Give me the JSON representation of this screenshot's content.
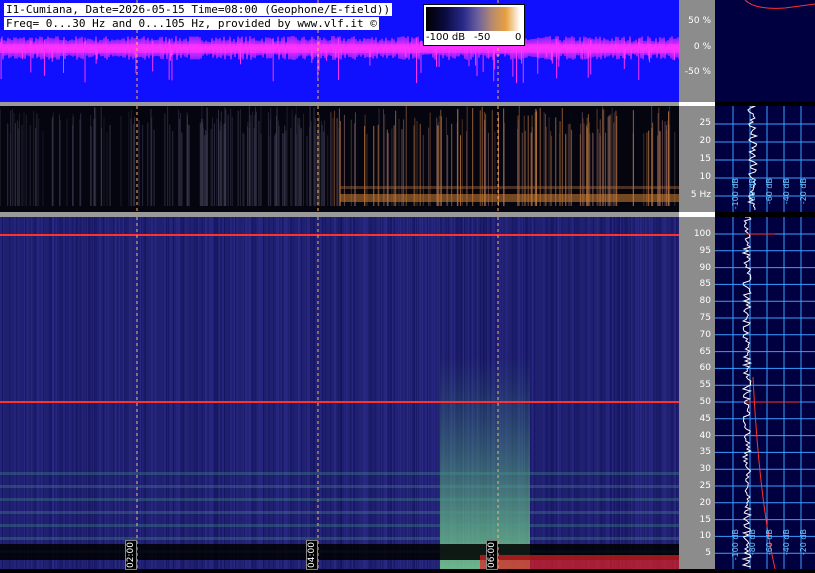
{
  "header": {
    "line1": "I1-Cumiana, Date=2026-05-15 Time=08:00 (Geophone/E-field))",
    "line2": "Freq= 0...30 Hz and 0...105 Hz, provided by www.vlf.it ©"
  },
  "colorbar": {
    "labels": [
      "-100 dB",
      "-50",
      "0"
    ]
  },
  "waveform_axis": {
    "ticks": [
      "50 %",
      "0 %",
      "-50 %"
    ]
  },
  "low_freq_axis": {
    "ticks": [
      "25",
      "20",
      "15",
      "10",
      "5 Hz"
    ]
  },
  "high_freq_axis": {
    "ticks": [
      "100",
      "95",
      "90",
      "85",
      "80",
      "75",
      "70",
      "65",
      "60",
      "55",
      "50",
      "45",
      "40",
      "35",
      "30",
      "25",
      "20",
      "15",
      "10",
      "5"
    ]
  },
  "time_markers": [
    "02:00",
    "04:00",
    "06:00"
  ],
  "side_panel_top": {
    "labels": [
      "-100 dB",
      "-80 dB",
      "-60 dB",
      "-40 dB",
      "-20 dB"
    ]
  },
  "side_panel_bottom": {
    "labels": [
      "-100 dB",
      "-80 dB",
      "-60 dB",
      "-40 dB",
      "-20 dB"
    ]
  },
  "colors": {
    "waveform_bg": "#1010ff",
    "waveform_trace": "#ff33ff",
    "spectrogram_bg": "#202070",
    "mains_line": "#ff3030",
    "axis_bg": "#8c8c8c",
    "side_bg": "#000040",
    "side_grid": "#3aa0ff"
  }
}
